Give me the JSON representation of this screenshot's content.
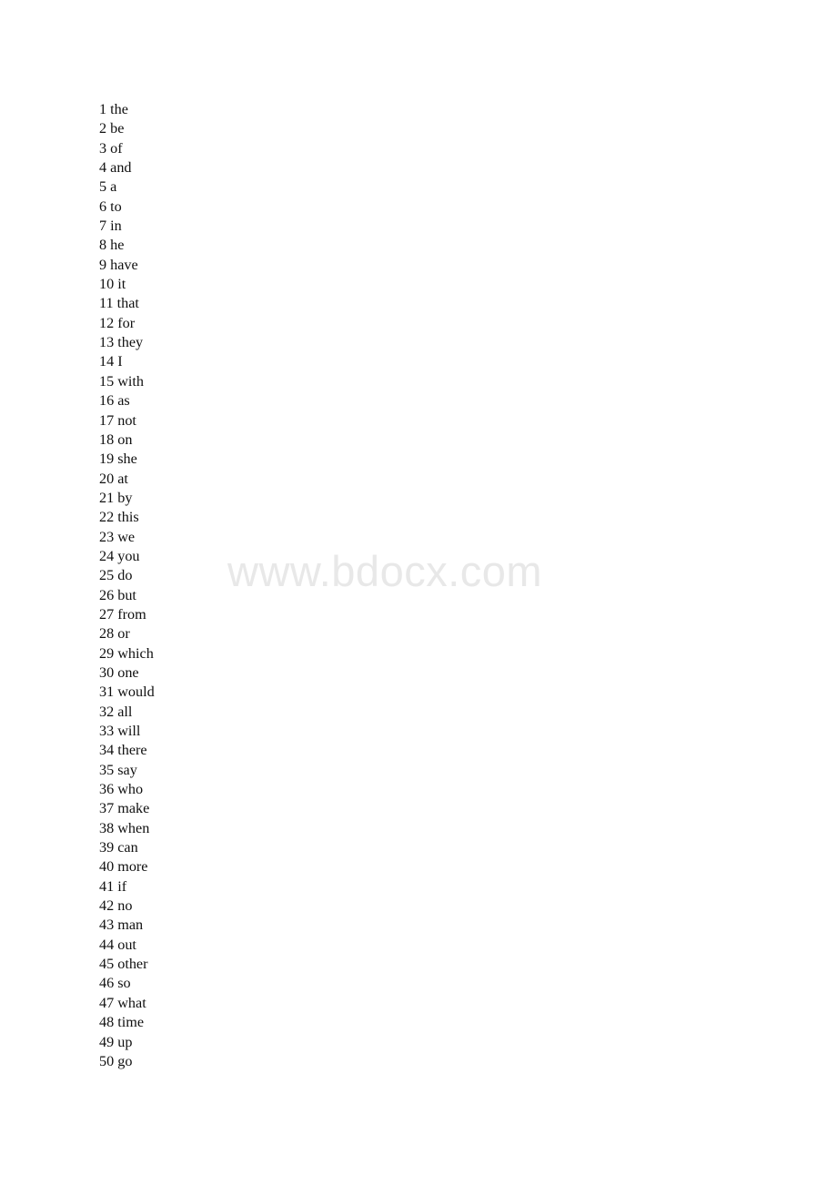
{
  "document": {
    "type": "word-frequency-list",
    "background_color": "#ffffff",
    "text_color": "#101010"
  },
  "watermark": {
    "text": "www.bdocx.com",
    "color": "#e8e8e8"
  },
  "list": {
    "items": [
      {
        "rank": "1",
        "word": "the"
      },
      {
        "rank": "2",
        "word": "be"
      },
      {
        "rank": "3",
        "word": "of"
      },
      {
        "rank": "4",
        "word": "and"
      },
      {
        "rank": "5",
        "word": "a"
      },
      {
        "rank": "6",
        "word": "to"
      },
      {
        "rank": "7",
        "word": "in"
      },
      {
        "rank": "8",
        "word": "he"
      },
      {
        "rank": "9",
        "word": "have"
      },
      {
        "rank": "10",
        "word": "it"
      },
      {
        "rank": "11",
        "word": "that"
      },
      {
        "rank": "12",
        "word": "for"
      },
      {
        "rank": "13",
        "word": "they"
      },
      {
        "rank": "14",
        "word": "I"
      },
      {
        "rank": "15",
        "word": "with"
      },
      {
        "rank": "16",
        "word": "as"
      },
      {
        "rank": "17",
        "word": "not"
      },
      {
        "rank": "18",
        "word": "on"
      },
      {
        "rank": "19",
        "word": "she"
      },
      {
        "rank": "20",
        "word": "at"
      },
      {
        "rank": "21",
        "word": "by"
      },
      {
        "rank": "22",
        "word": "this"
      },
      {
        "rank": "23",
        "word": "we"
      },
      {
        "rank": "24",
        "word": "you"
      },
      {
        "rank": "25",
        "word": "do"
      },
      {
        "rank": "26",
        "word": "but"
      },
      {
        "rank": "27",
        "word": "from"
      },
      {
        "rank": "28",
        "word": "or"
      },
      {
        "rank": "29",
        "word": "which"
      },
      {
        "rank": "30",
        "word": "one"
      },
      {
        "rank": "31",
        "word": "would"
      },
      {
        "rank": "32",
        "word": "all"
      },
      {
        "rank": "33",
        "word": "will"
      },
      {
        "rank": "34",
        "word": "there"
      },
      {
        "rank": "35",
        "word": "say"
      },
      {
        "rank": "36",
        "word": "who"
      },
      {
        "rank": "37",
        "word": "make"
      },
      {
        "rank": "38",
        "word": "when"
      },
      {
        "rank": "39",
        "word": "can"
      },
      {
        "rank": "40",
        "word": "more"
      },
      {
        "rank": "41",
        "word": "if"
      },
      {
        "rank": "42",
        "word": "no"
      },
      {
        "rank": "43",
        "word": "man"
      },
      {
        "rank": "44",
        "word": "out"
      },
      {
        "rank": "45",
        "word": "other"
      },
      {
        "rank": "46",
        "word": "so"
      },
      {
        "rank": "47",
        "word": "what"
      },
      {
        "rank": "48",
        "word": "time"
      },
      {
        "rank": "49",
        "word": "up"
      },
      {
        "rank": "50",
        "word": "go"
      }
    ]
  }
}
